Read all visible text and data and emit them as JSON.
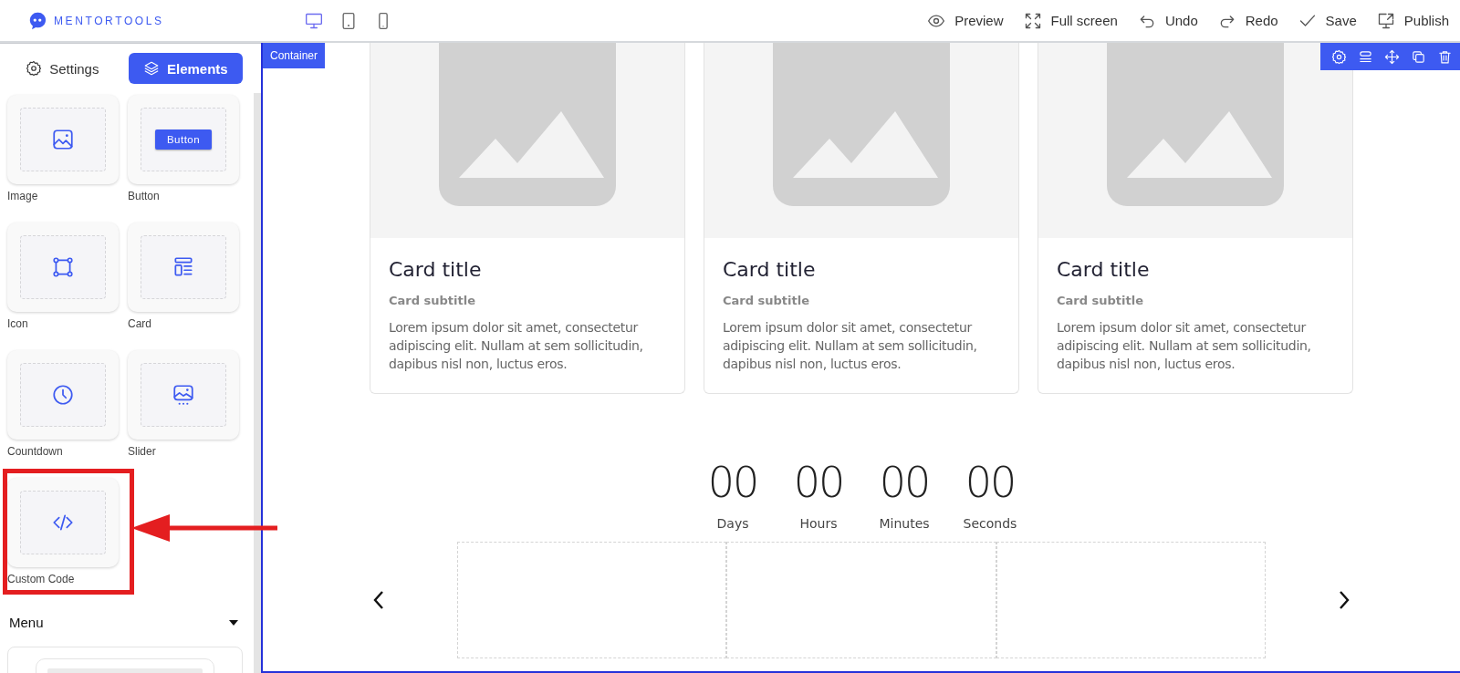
{
  "brand": {
    "name": "MENTORTOOLS"
  },
  "devices": [
    {
      "kind": "desktop",
      "selected": true
    },
    {
      "kind": "tablet",
      "selected": false
    },
    {
      "kind": "mobile",
      "selected": false
    }
  ],
  "actions": [
    {
      "kind": "preview",
      "label": "Preview"
    },
    {
      "kind": "fullscreen",
      "label": "Full screen"
    },
    {
      "kind": "undo",
      "label": "Undo"
    },
    {
      "kind": "redo",
      "label": "Redo"
    },
    {
      "kind": "save",
      "label": "Save"
    },
    {
      "kind": "publish",
      "label": "Publish"
    }
  ],
  "sidebar": {
    "tabs": [
      {
        "kind": "settings",
        "label": "Settings",
        "selected": false
      },
      {
        "kind": "elements",
        "label": "Elements",
        "selected": true
      }
    ],
    "elements": [
      {
        "kind": "image",
        "label": "Image"
      },
      {
        "kind": "button",
        "label": "Button"
      },
      {
        "kind": "icon",
        "label": "Icon"
      },
      {
        "kind": "card",
        "label": "Card"
      },
      {
        "kind": "countdown",
        "label": "Countdown"
      },
      {
        "kind": "slider",
        "label": "Slider"
      },
      {
        "kind": "code",
        "label": "Custom Code",
        "highlighted": true
      }
    ],
    "button_preview": {
      "text": "Button"
    },
    "section": {
      "title": "Menu",
      "expanded": true
    }
  },
  "canvas": {
    "badge": "Container",
    "cards": [
      {
        "title": "Card title",
        "subtitle": "Card subtitle",
        "text": "Lorem ipsum dolor sit amet, consectetur adipiscing elit. Nullam at sem sollicitudin, dapibus nisl non, luctus eros."
      },
      {
        "title": "Card title",
        "subtitle": "Card subtitle",
        "text": "Lorem ipsum dolor sit amet, consectetur adipiscing elit. Nullam at sem sollicitudin, dapibus nisl non, luctus eros."
      },
      {
        "title": "Card title",
        "subtitle": "Card subtitle",
        "text": "Lorem ipsum dolor sit amet, consectetur adipiscing elit. Nullam at sem sollicitudin, dapibus nisl non, luctus eros."
      }
    ],
    "countdown": [
      {
        "value": "00",
        "unit": "Days"
      },
      {
        "value": "00",
        "unit": "Hours"
      },
      {
        "value": "00",
        "unit": "Minutes"
      },
      {
        "value": "00",
        "unit": "Seconds"
      }
    ]
  }
}
